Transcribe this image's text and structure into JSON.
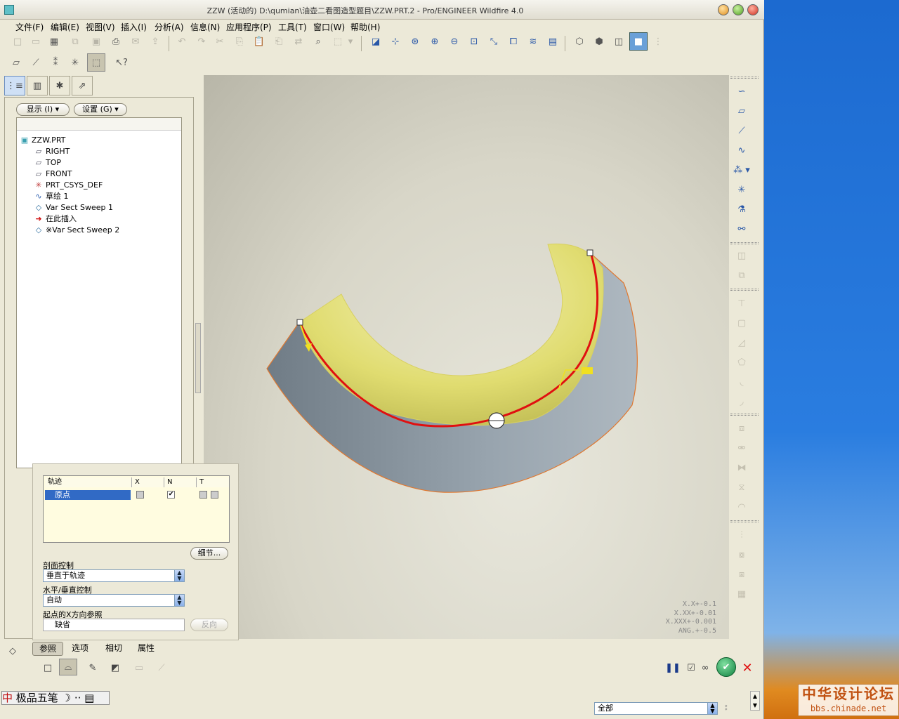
{
  "window": {
    "title": "ZZW (活动的) D:\\qumian\\油壶二看图造型题目\\ZZW.PRT.2 - Pro/ENGINEER Wildfire 4.0"
  },
  "menubar": {
    "items": [
      "文件(F)",
      "编辑(E)",
      "视图(V)",
      "插入(I)",
      "分析(A)",
      "信息(N)",
      "应用程序(P)",
      "工具(T)",
      "窗口(W)",
      "帮助(H)"
    ]
  },
  "model_tree": {
    "show_button": "显示 (I)",
    "settings_button": "设置 (G)",
    "items": [
      "ZZW.PRT",
      "RIGHT",
      "TOP",
      "FRONT",
      "PRT_CSYS_DEF",
      "草绘 1",
      "Var Sect Sweep 1",
      "在此插入",
      "※Var Sect Sweep 2"
    ]
  },
  "viewport": {
    "precision_lines": [
      "X.X+-0.1",
      "X.XX+-0.01",
      "X.XXX+-0.001",
      "ANG.+-0.5"
    ],
    "colors": {
      "surface_yellow": "#e0dc70",
      "surface_grey": "#98a4ae",
      "trajectory": "#e01010",
      "edge": "#e07830"
    }
  },
  "references_panel": {
    "table_headers": [
      "轨迹",
      "X",
      "N",
      "T"
    ],
    "rows": [
      {
        "name": "原点",
        "x": false,
        "n": true,
        "t": false
      }
    ],
    "details_button": "细节...",
    "section_control_label": "剖面控制",
    "section_control_value": "垂直于轨迹",
    "hv_control_label": "水平/垂直控制",
    "hv_control_value": "自动",
    "x_ref_label": "起点的X方向参照",
    "x_ref_value": "缺省",
    "flip_button": "反向"
  },
  "dashboard": {
    "tabs": [
      "参照",
      "选项",
      "相切",
      "属性"
    ]
  },
  "statusbar": {
    "ime_text": "极品五笔",
    "filter_value": "全部"
  },
  "watermark": {
    "line1": "中华设计论坛",
    "line2": "bbs.chinade.net"
  }
}
